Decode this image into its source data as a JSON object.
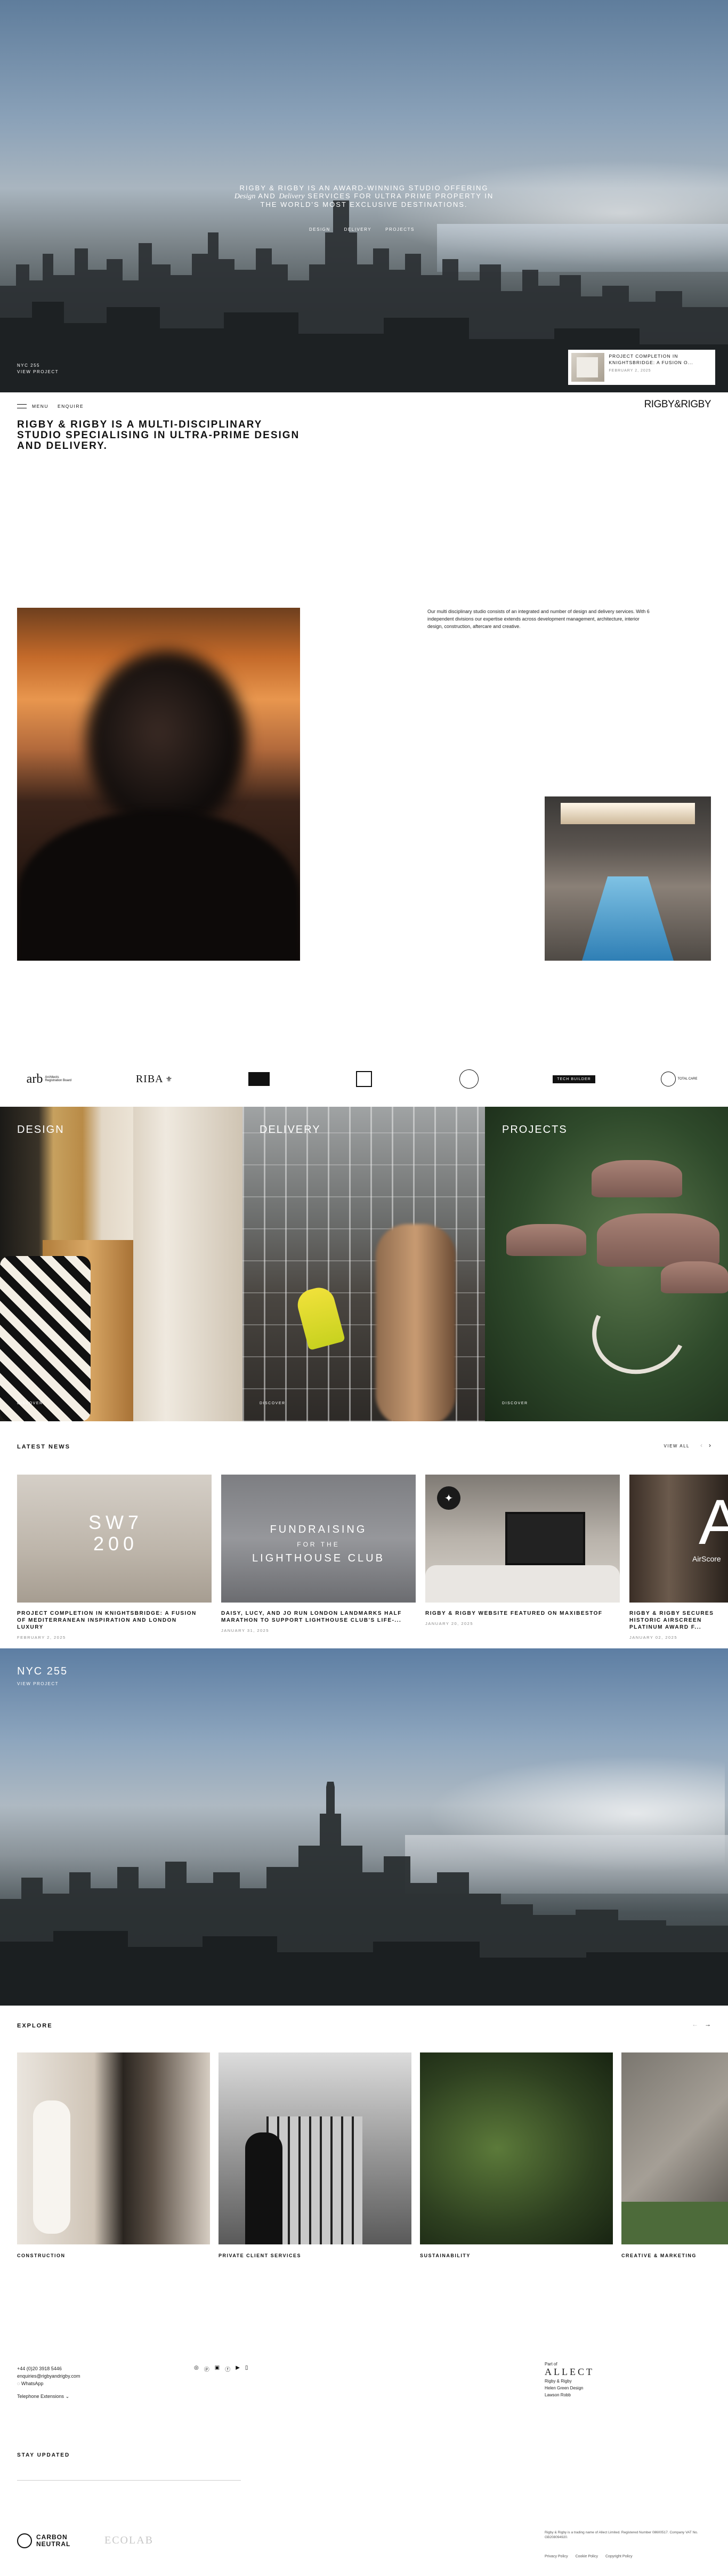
{
  "hero": {
    "line1": "RIGBY & RIGBY IS AN AWARD-WINNING STUDIO OFFERING",
    "line2a": "Design",
    "line2b": " AND ",
    "line2c": "Delivery",
    "line2d": " SERVICES FOR ULTRA PRIME PROPERTY IN",
    "line3": "THE WORLD'S MOST EXCLUSIVE DESTINATIONS.",
    "links": [
      "DESIGN",
      "DELIVERY",
      "PROJECTS"
    ],
    "project_name": "NYC 255",
    "project_link": "VIEW PROJECT",
    "card_title": "PROJECT COMPLETION IN KNIGHTSBRIDGE: A FUSION O...",
    "card_date": "FEBRUARY 2, 2025"
  },
  "header": {
    "menu": "MENU",
    "enquire": "ENQUIRE",
    "logo": "RIGBY&RIGBY"
  },
  "intro": {
    "headline": "RIGBY & RIGBY IS A MULTI-DISCIPLINARY STUDIO SPECIALISING IN ULTRA-PRIME DESIGN AND DELIVERY.",
    "body": "Our multi disciplinary studio consists of an integrated and number of design and delivery services. With 6 independent divisions our expertise extends across development management, architecture, interior design, construction, aftercare and creative."
  },
  "awards": [
    "arb",
    "Architects Registration Board",
    "RIBA",
    "TECH BUILDER",
    "TOTAL CARE"
  ],
  "services": [
    {
      "label": "DESIGN",
      "cta": "DISCOVER"
    },
    {
      "label": "DELIVERY",
      "cta": "DISCOVER"
    },
    {
      "label": "PROJECTS",
      "cta": "DISCOVER"
    }
  ],
  "news": {
    "title": "LATEST NEWS",
    "view_all": "VIEW ALL",
    "items": [
      {
        "title": "PROJECT COMPLETION IN KNIGHTSBRIDGE: A FUSION OF MEDITERRANEAN INSPIRATION AND LONDON LUXURY",
        "date": "FEBRUARY 2, 2025",
        "img_text": "SW7\n200"
      },
      {
        "title": "DAISY, LUCY, AND JO RUN LONDON LANDMARKS HALF MARATHON TO SUPPORT LIGHTHOUSE CLUB'S LIFE-...",
        "date": "JANUARY 31, 2025",
        "img_text1": "FUNDRAISING",
        "img_text2": "FOR THE",
        "img_text3": "LIGHTHOUSE CLUB"
      },
      {
        "title": "RIGBY & RIGBY WEBSITE FEATURED ON MAXIBESTOF",
        "date": "JANUARY 20, 2025"
      },
      {
        "title": "RIGBY & RIGBY SECURES HISTORIC AIRSCREEN PLATINUM AWARD F...",
        "date": "JANUARY 02, 2025",
        "img_text": "AirScore"
      }
    ]
  },
  "banner": {
    "title": "NYC 255",
    "link": "VIEW PROJECT"
  },
  "explore": {
    "title": "EXPLORE",
    "items": [
      "CONSTRUCTION",
      "PRIVATE CLIENT SERVICES",
      "SUSTAINABILITY",
      "CREATIVE & MARKETING"
    ]
  },
  "footer": {
    "phone": "+44 (0)20 3918 5446",
    "email": "enquiries@rigbyandrigby.com",
    "whatsapp": "WhatsApp",
    "telephone_ext": "Telephone Extensions",
    "part_of": "Part of",
    "allect": "ALLECT",
    "brands": [
      "Rigby & Rigby",
      "Helen Green Design",
      "Lawson Robb"
    ],
    "stay_updated": "STAY UPDATED",
    "carbon1": "CARBON",
    "carbon2": "NEUTRAL",
    "ecolab": "ECOLAB",
    "legal": "Rigby & Rigby is a trading name of Allect Limited. Registered Number 08600517. Company VAT No. GB208094920.",
    "links": [
      "Privacy Policy",
      "Cookie Policy",
      "Copyright Policy"
    ]
  }
}
